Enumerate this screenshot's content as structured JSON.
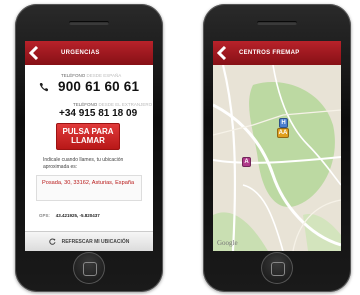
{
  "screen1": {
    "title": "URGENCIAS",
    "phone_label_1": "TELÉFONO",
    "phone_label_1_dim": "DESDE ESPAÑA",
    "phone_number_1": "900 61 60 61",
    "phone_label_2": "TELÉFONO",
    "phone_label_2_dim": "DESDE EL EXTRANJERO",
    "phone_number_2": "+34 915 81 18 09",
    "call_button_line1": "PULSA PARA",
    "call_button_line2": "LLAMAR",
    "hint": "Indicale cuando llames, tu ubicación aproximada es:",
    "address": "Posada, 30, 33162, Asturias, España",
    "gps_label": "GPS:",
    "gps_value": "43.421925, -5.820437",
    "refresh_label": "REFRESCAR MI UBICACIÓN"
  },
  "screen2": {
    "title": "CENTROS FREMAP",
    "map_brand": "Google",
    "pins": [
      {
        "label": "H",
        "color": "#4a7fd0"
      },
      {
        "label": "AA",
        "color": "#e0a020"
      },
      {
        "label": "A",
        "color": "#b03a8a"
      }
    ]
  },
  "colors": {
    "header_red": "#a3161d",
    "call_red": "#d02a2a",
    "address_red": "#b81818",
    "park_green": "#b9d8a0"
  }
}
